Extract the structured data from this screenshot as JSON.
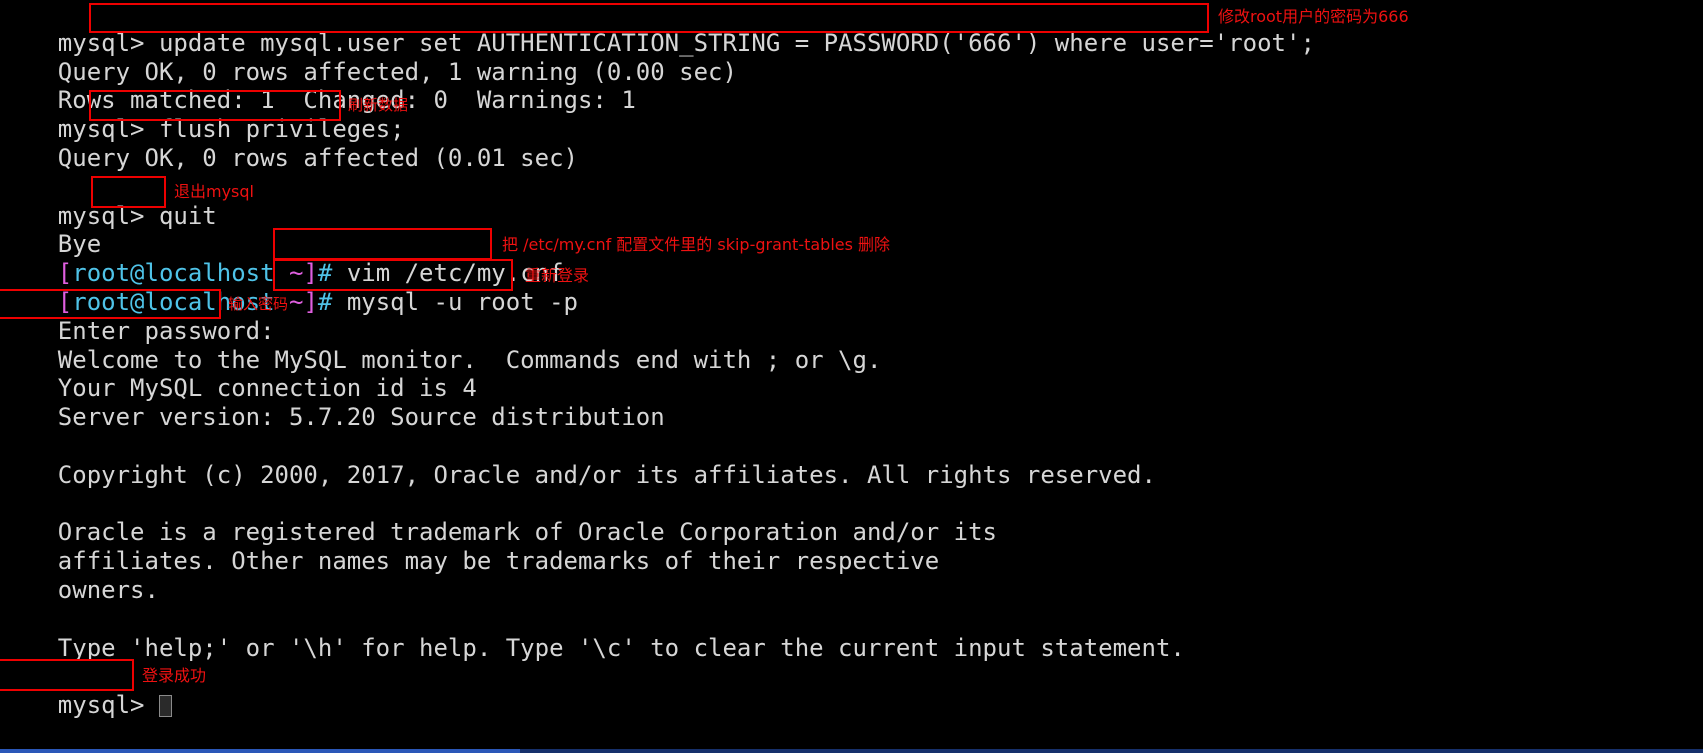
{
  "terminal": {
    "background": "#000000",
    "foreground": "#d6d6d6",
    "annotation_color": "#ee1111",
    "prompt_colors": {
      "bracket": "#e05fe0",
      "user_host": "#4fc3e8",
      "hash": "#4fc3e8"
    },
    "lines": [
      {
        "id": "l1",
        "prompt": "mysql> ",
        "text": "update mysql.user set AUTHENTICATION_STRING = PASSWORD('666') where user='root';"
      },
      {
        "id": "l2",
        "text": "Query OK, 0 rows affected, 1 warning (0.00 sec)"
      },
      {
        "id": "l3",
        "text": "Rows matched: 1  Changed: 0  Warnings: 1"
      },
      {
        "id": "l4",
        "prompt": "mysql> ",
        "text": "flush privileges;"
      },
      {
        "id": "l5",
        "text": "Query OK, 0 rows affected (0.01 sec)"
      },
      {
        "id": "l6",
        "text": ""
      },
      {
        "id": "l7",
        "prompt": "mysql> ",
        "text": "quit"
      },
      {
        "id": "l8",
        "text": "Bye"
      },
      {
        "id": "l9",
        "shell_prompt": true,
        "bracket_open": "[",
        "user_host": "root@localhost",
        "tilde": " ~]",
        "hash": "# ",
        "text": "vim /etc/my.cnf"
      },
      {
        "id": "l10",
        "shell_prompt": true,
        "bracket_open": "[",
        "user_host": "root@localhost",
        "tilde": " ~]",
        "hash": "# ",
        "text": "mysql -u root -p"
      },
      {
        "id": "l11",
        "text": "Enter password: "
      },
      {
        "id": "l12",
        "text": "Welcome to the MySQL monitor.  Commands end with ; or \\g."
      },
      {
        "id": "l13",
        "text": "Your MySQL connection id is 4"
      },
      {
        "id": "l14",
        "text": "Server version: 5.7.20 Source distribution"
      },
      {
        "id": "l15",
        "text": ""
      },
      {
        "id": "l16",
        "text": "Copyright (c) 2000, 2017, Oracle and/or its affiliates. All rights reserved."
      },
      {
        "id": "l17",
        "text": ""
      },
      {
        "id": "l18",
        "text": "Oracle is a registered trademark of Oracle Corporation and/or its"
      },
      {
        "id": "l19",
        "text": "affiliates. Other names may be trademarks of their respective"
      },
      {
        "id": "l20",
        "text": "owners."
      },
      {
        "id": "l21",
        "text": ""
      },
      {
        "id": "l22",
        "text": "Type 'help;' or '\\h' for help. Type '\\c' to clear the current input statement."
      },
      {
        "id": "l23",
        "text": ""
      },
      {
        "id": "l24",
        "prompt": "mysql> ",
        "text": ""
      }
    ]
  },
  "annotations": {
    "update_password": "修改root用户的密码为666",
    "flush": "刷新数据",
    "quit": "退出mysql",
    "vim_config": "把 /etc/my.cnf 配置文件里的 skip-grant-tables 删除",
    "relogin": "重新登录",
    "enter_password": "输入密码",
    "login_success": "登录成功"
  }
}
